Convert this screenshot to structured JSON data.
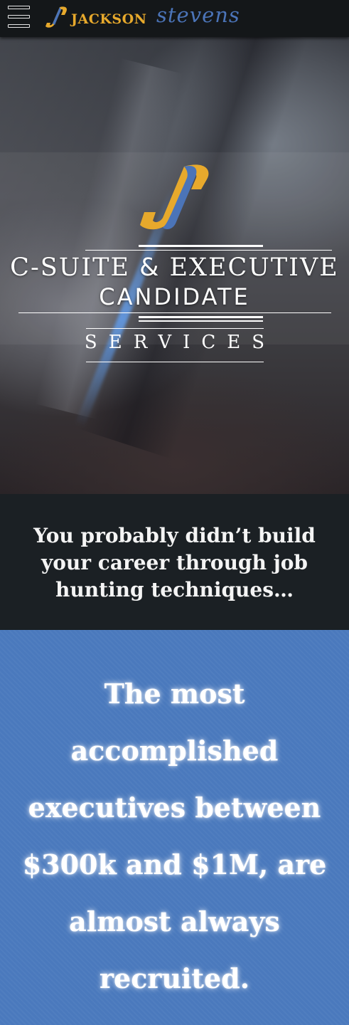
{
  "header": {
    "menu_label": "menu",
    "logo": {
      "brand_first": "JACKSON",
      "brand_second": "stevens",
      "colors": {
        "gold": "#e7a92c",
        "blue": "#4b74b8"
      }
    }
  },
  "hero": {
    "title_line_1_a": "C-SUITE ",
    "title_line_1_amp": "&",
    "title_line_1_b": " EXECUTIVE",
    "title_line_2": "CANDIDATE",
    "subtitle": "SERVICES"
  },
  "statement": {
    "text": "You probably didn’t build your career through job hunting techniques…"
  },
  "highlight": {
    "text": "The most accomplished executives between $300k and $1M, are almost always recruited."
  },
  "colors": {
    "topbar": "#141719",
    "dark_band": "#1b2024",
    "blue_band": "#4a79bd"
  }
}
